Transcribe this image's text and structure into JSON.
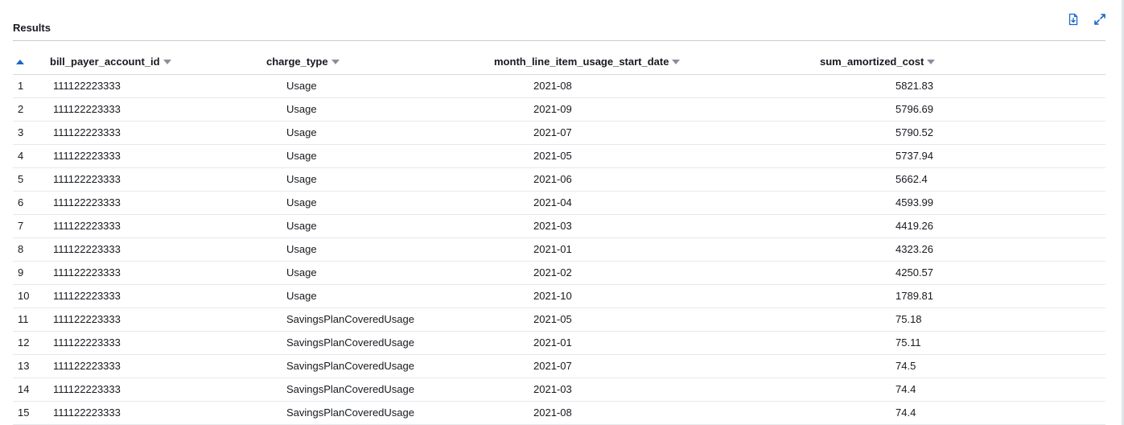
{
  "panel": {
    "title": "Results"
  },
  "toolbar": {
    "download_icon": "download-file-icon",
    "expand_icon": "expand-icon"
  },
  "colors": {
    "accent": "#1b66c9",
    "text": "#16191f",
    "caret": "#8a9099"
  },
  "table": {
    "sort": {
      "column": "row_index",
      "direction": "ascending"
    },
    "columns": [
      "bill_payer_account_id",
      "charge_type",
      "month_line_item_usage_start_date",
      "sum_amortized_cost"
    ],
    "rows": [
      [
        "1",
        "111122223333",
        "Usage",
        "2021-08",
        "5821.83"
      ],
      [
        "2",
        "111122223333",
        "Usage",
        "2021-09",
        "5796.69"
      ],
      [
        "3",
        "111122223333",
        "Usage",
        "2021-07",
        "5790.52"
      ],
      [
        "4",
        "111122223333",
        "Usage",
        "2021-05",
        "5737.94"
      ],
      [
        "5",
        "111122223333",
        "Usage",
        "2021-06",
        "5662.4"
      ],
      [
        "6",
        "111122223333",
        "Usage",
        "2021-04",
        "4593.99"
      ],
      [
        "7",
        "111122223333",
        "Usage",
        "2021-03",
        "4419.26"
      ],
      [
        "8",
        "111122223333",
        "Usage",
        "2021-01",
        "4323.26"
      ],
      [
        "9",
        "111122223333",
        "Usage",
        "2021-02",
        "4250.57"
      ],
      [
        "10",
        "111122223333",
        "Usage",
        "2021-10",
        "1789.81"
      ],
      [
        "11",
        "111122223333",
        "SavingsPlanCoveredUsage",
        "2021-05",
        "75.18"
      ],
      [
        "12",
        "111122223333",
        "SavingsPlanCoveredUsage",
        "2021-01",
        "75.11"
      ],
      [
        "13",
        "111122223333",
        "SavingsPlanCoveredUsage",
        "2021-07",
        "74.5"
      ],
      [
        "14",
        "111122223333",
        "SavingsPlanCoveredUsage",
        "2021-03",
        "74.4"
      ],
      [
        "15",
        "111122223333",
        "SavingsPlanCoveredUsage",
        "2021-08",
        "74.4"
      ]
    ]
  }
}
